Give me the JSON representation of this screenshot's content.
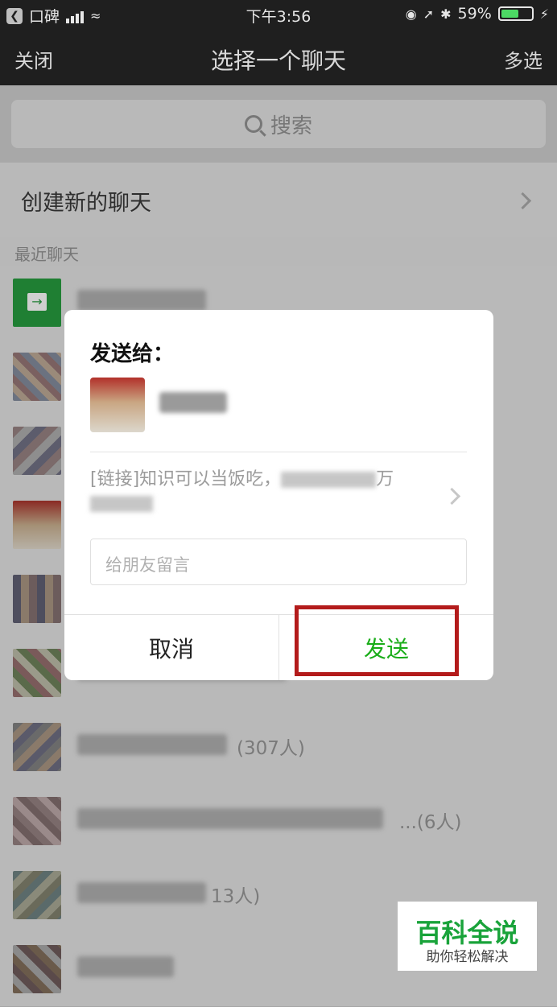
{
  "status_bar": {
    "carrier": "口碑",
    "time": "下午3:56",
    "battery": "59%",
    "battery_level": 0.59
  },
  "nav": {
    "close": "关闭",
    "title": "选择一个聊天",
    "multi": "多选"
  },
  "search": {
    "placeholder": "搜索"
  },
  "new_chat": "创建新的聊天",
  "recent_header": "最近聊天",
  "visible_counts": [
    "(307人)",
    "...(6人)",
    "13人)"
  ],
  "dialog": {
    "send_to": "发送给：",
    "link_prefix": "[链接]知识可以当饭吃，",
    "link_mid": "万",
    "message_placeholder": "给朋友留言",
    "cancel": "取消",
    "send": "发送"
  },
  "watermark": {
    "title": "百科全说",
    "subtitle": "助你轻松解决"
  },
  "colors": {
    "accent_green": "#1aad19",
    "highlight_red": "#b31b1b",
    "watermark_green": "#19a33a"
  }
}
